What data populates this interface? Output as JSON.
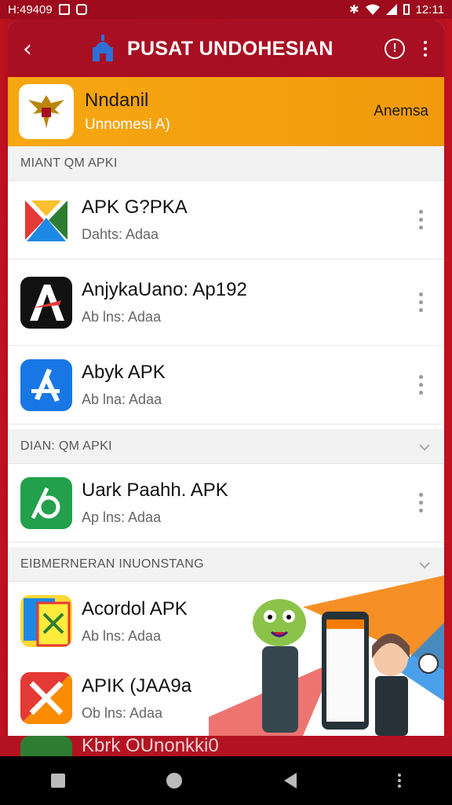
{
  "status": {
    "left_text": "H:49409",
    "time": "12:11"
  },
  "appbar": {
    "title": "PUSAT UNDOHESIAN",
    "back_icon": "back-arrow-icon",
    "info_icon": "info-icon"
  },
  "banner": {
    "name": "Nndanil",
    "subtitle": "Unnomesi A)",
    "action": "Anemsa"
  },
  "sections": [
    {
      "title": "MIANT QM APKI",
      "items": [
        {
          "name": "APK G?PKA",
          "sub": "Dahts: Adaa"
        },
        {
          "name": "AnjykaUano: Ap192",
          "sub": "Ab lns: Adaa"
        },
        {
          "name": "Abyk APK",
          "sub": "Ab lna: Adaa"
        }
      ]
    },
    {
      "title": "DIAN: QM APKI",
      "items": [
        {
          "name": "Uark Paahh. APK",
          "sub": "Ap lns: Adaa"
        }
      ]
    },
    {
      "title": "EIBMERNERAN INUONSTANG",
      "items": [
        {
          "name": "Acordol APK",
          "sub": "Ab lns: Adaa"
        },
        {
          "name": "APIK (JAA9a",
          "sub": "Ob lns: Adaa"
        },
        {
          "name": "Kbrk OUnonkki0",
          "sub": ""
        }
      ]
    }
  ],
  "colors": {
    "brand_red": "#a80f22",
    "banner_orange": "#f7a712"
  }
}
